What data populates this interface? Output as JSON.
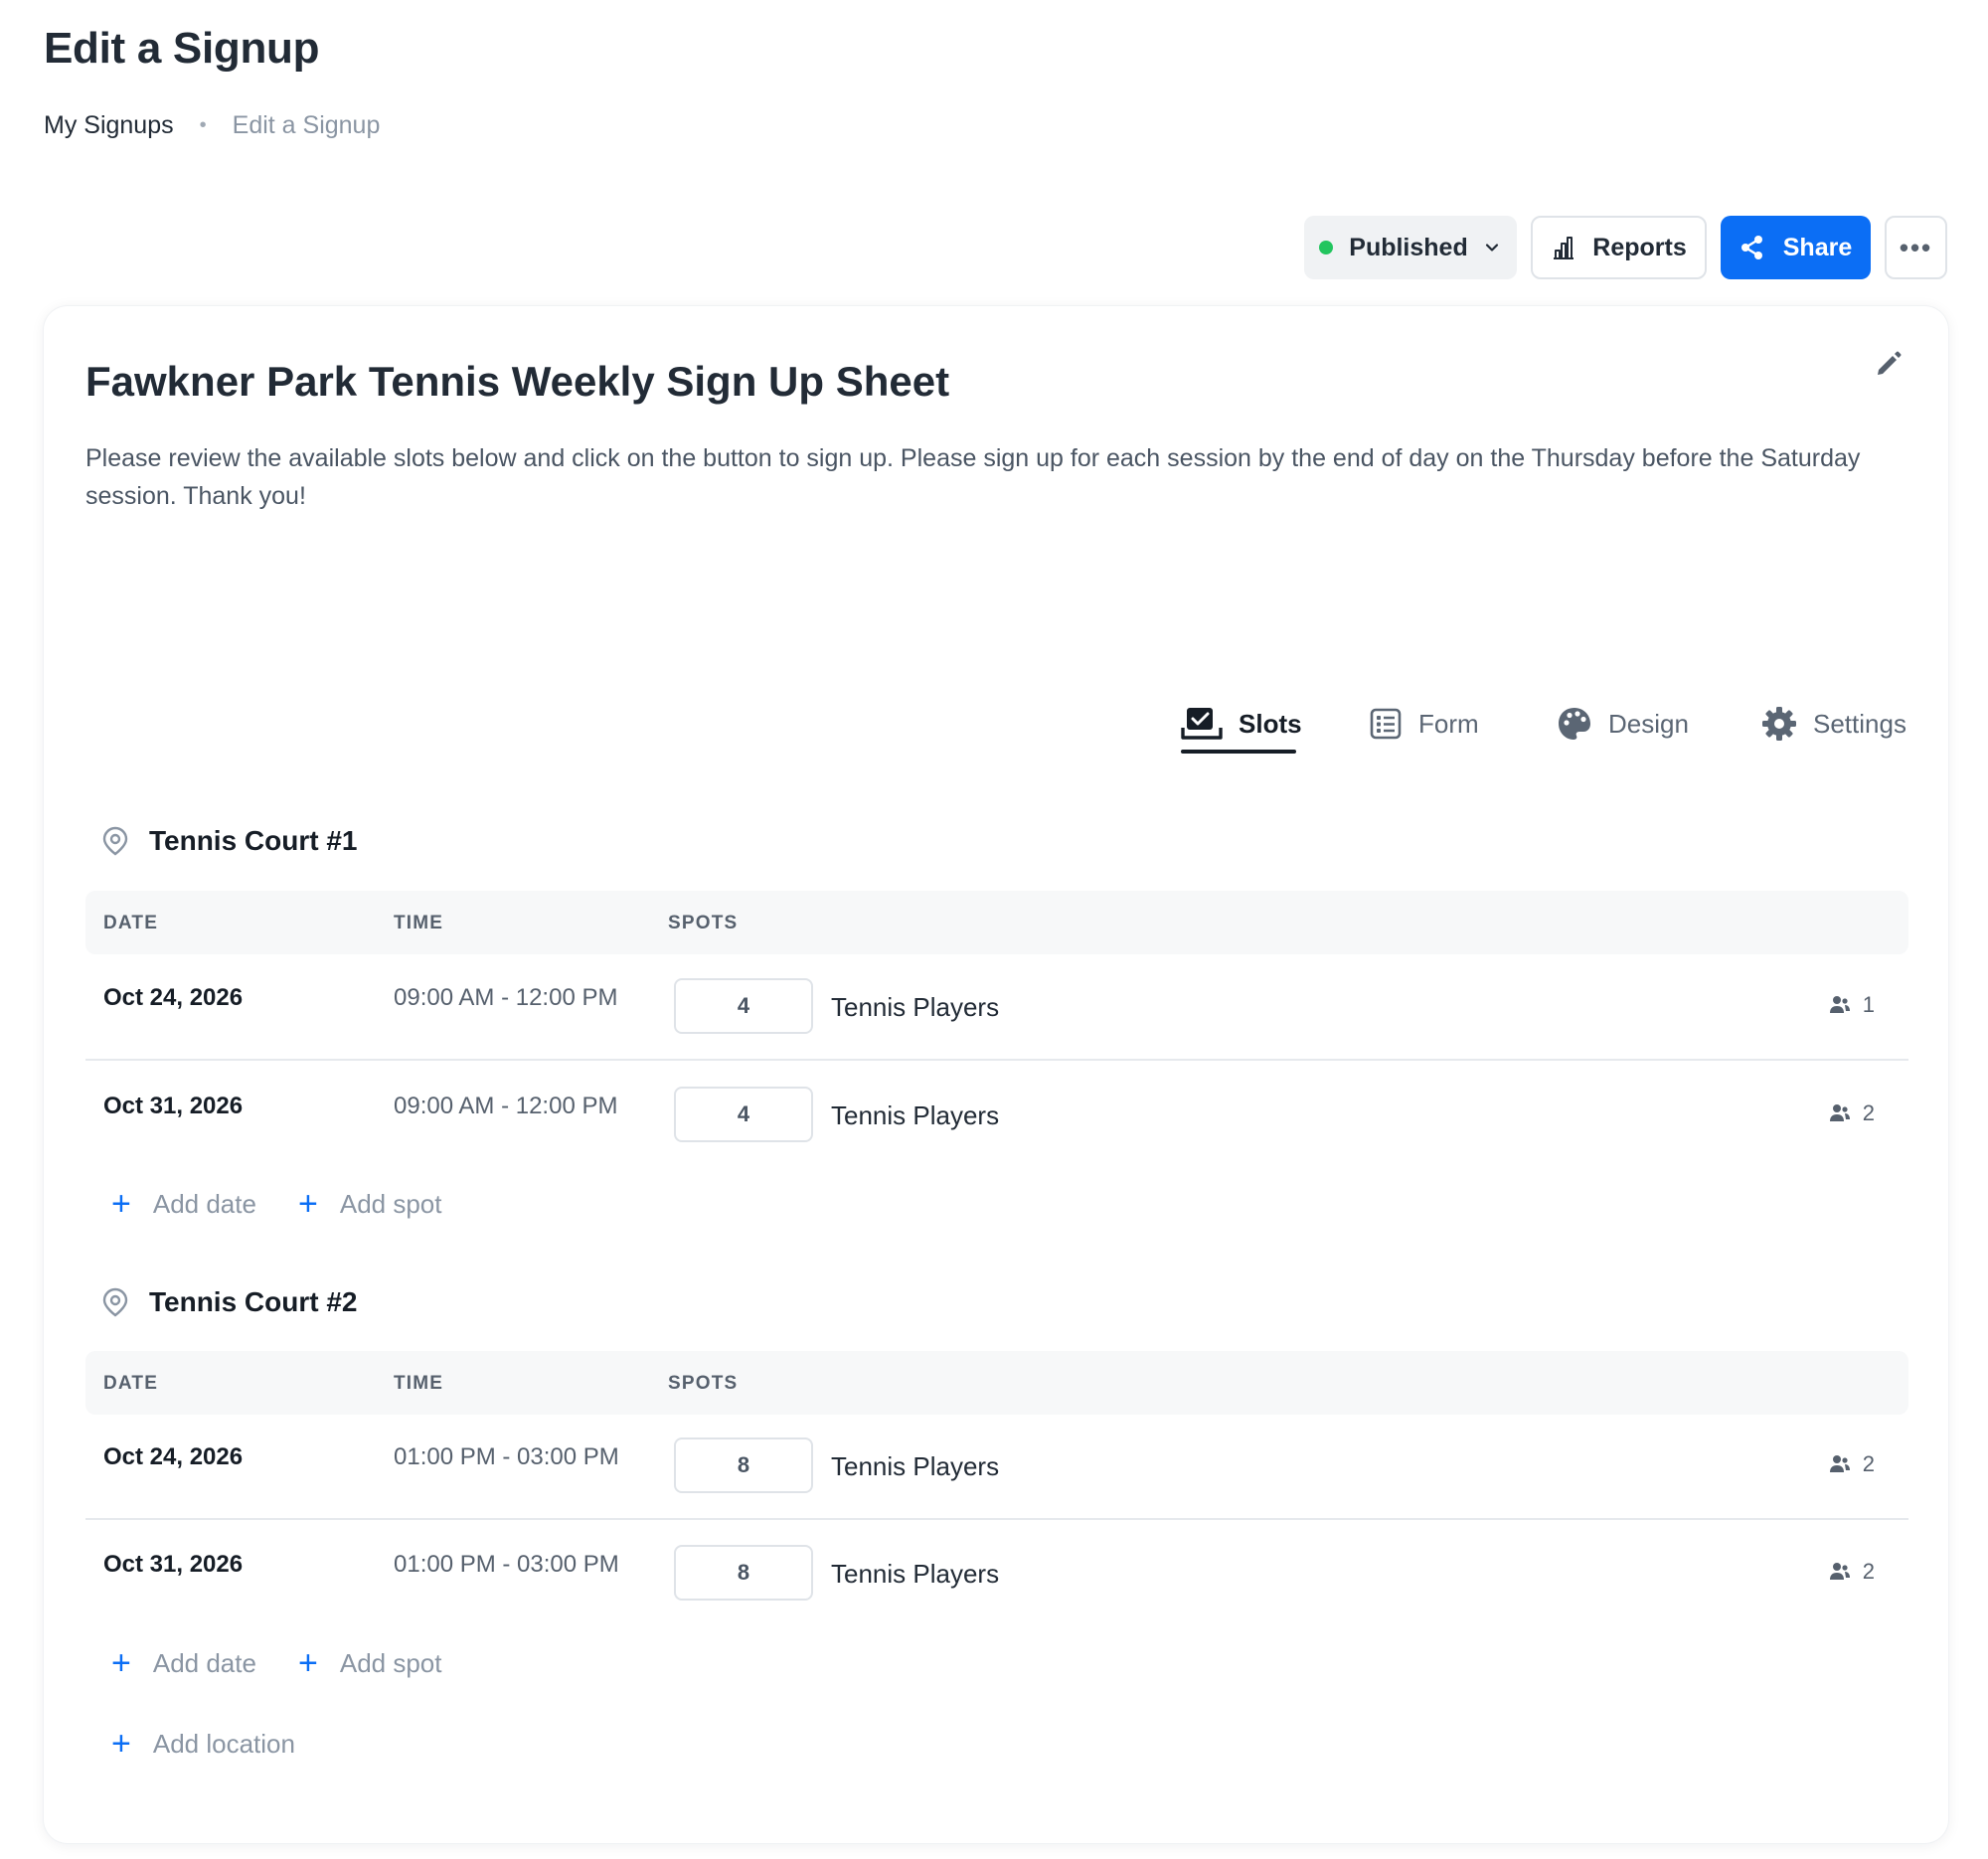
{
  "page": {
    "title": "Edit a Signup",
    "breadcrumb": [
      {
        "label": "My Signups"
      },
      {
        "label": "Edit a Signup"
      }
    ]
  },
  "toolbar": {
    "status_label": "Published",
    "status_color": "#22c55e",
    "reports_label": "Reports",
    "share_label": "Share",
    "more_label": "•••",
    "accent_color": "#0b6ef5"
  },
  "signup": {
    "title": "Fawkner Park Tennis Weekly Sign Up Sheet",
    "description": "Please review the available slots below and click on the button to sign up. Please sign up for each session by the end of day on the Thursday before the Saturday session. Thank you!"
  },
  "tabs": [
    {
      "label": "Slots",
      "icon": "slots-checkbox-icon",
      "active": true
    },
    {
      "label": "Form",
      "icon": "form-list-icon",
      "active": false
    },
    {
      "label": "Design",
      "icon": "palette-icon",
      "active": false
    },
    {
      "label": "Settings",
      "icon": "gear-icon",
      "active": false
    }
  ],
  "table_headers": {
    "date": "DATE",
    "time": "TIME",
    "spots": "SPOTS"
  },
  "locations": [
    {
      "name": "Tennis Court #1",
      "rows": [
        {
          "date": "Oct 24, 2026",
          "time": "09:00 AM - 12:00 PM",
          "spots": "4",
          "role": "Tennis Players",
          "signed_up": "1"
        },
        {
          "date": "Oct 31, 2026",
          "time": "09:00 AM - 12:00 PM",
          "spots": "4",
          "role": "Tennis Players",
          "signed_up": "2"
        }
      ],
      "add_date_label": "Add date",
      "add_spot_label": "Add spot"
    },
    {
      "name": "Tennis Court #2",
      "rows": [
        {
          "date": "Oct 24, 2026",
          "time": "01:00 PM - 03:00 PM",
          "spots": "8",
          "role": "Tennis Players",
          "signed_up": "2"
        },
        {
          "date": "Oct 31, 2026",
          "time": "01:00 PM - 03:00 PM",
          "spots": "8",
          "role": "Tennis Players",
          "signed_up": "2"
        }
      ],
      "add_date_label": "Add date",
      "add_spot_label": "Add spot"
    }
  ],
  "add_location_label": "Add location"
}
